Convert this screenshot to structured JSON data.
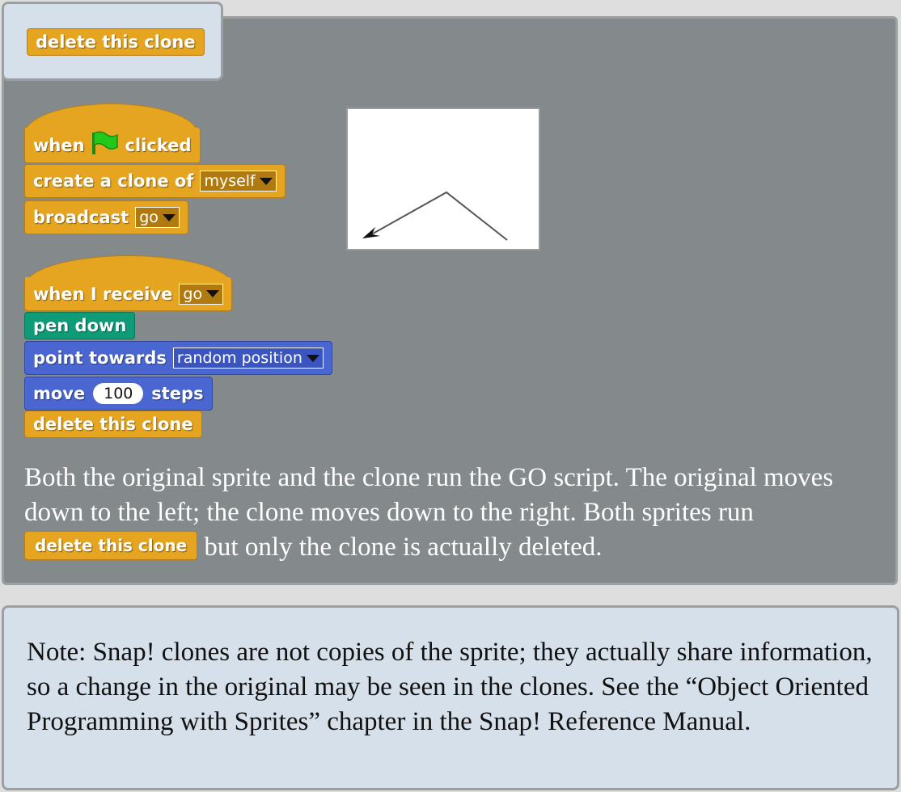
{
  "tab_block": {
    "label": "delete this clone"
  },
  "script1": {
    "hat": {
      "when": "when",
      "clicked": "clicked"
    },
    "create_clone": {
      "label": "create a clone of",
      "option": "myself"
    },
    "broadcast": {
      "label": "broadcast",
      "option": "go"
    }
  },
  "script2": {
    "hat": {
      "label": "when I receive",
      "option": "go"
    },
    "pen_down": {
      "label": "pen down"
    },
    "point_towards": {
      "label": "point towards",
      "option": "random position"
    },
    "move": {
      "label": "move",
      "value": "100",
      "suffix": "steps"
    },
    "delete_clone": {
      "label": "delete this clone"
    }
  },
  "caption": {
    "part1": "Both the original sprite and the clone run the GO script. The original moves down to the left; the clone moves down to the right. Both sprites run",
    "inline_block": "delete this clone",
    "part2": "but only the clone is actually deleted."
  },
  "note": {
    "text": "Note: Snap! clones are not copies of the sprite; they actually share information, so a change in the original may be seen in the clones. See the “Object Oriented Programming with Sprites” chapter in the Snap! Reference Manual."
  },
  "colors": {
    "control": "#e5a521",
    "pen": "#0e9b77",
    "motion": "#4a66d0",
    "panel": "#848a8c",
    "note_bg": "#d6e0ea"
  },
  "icons": [
    "green-flag-icon",
    "dropdown-arrow-icon",
    "arrowhead-icon"
  ]
}
